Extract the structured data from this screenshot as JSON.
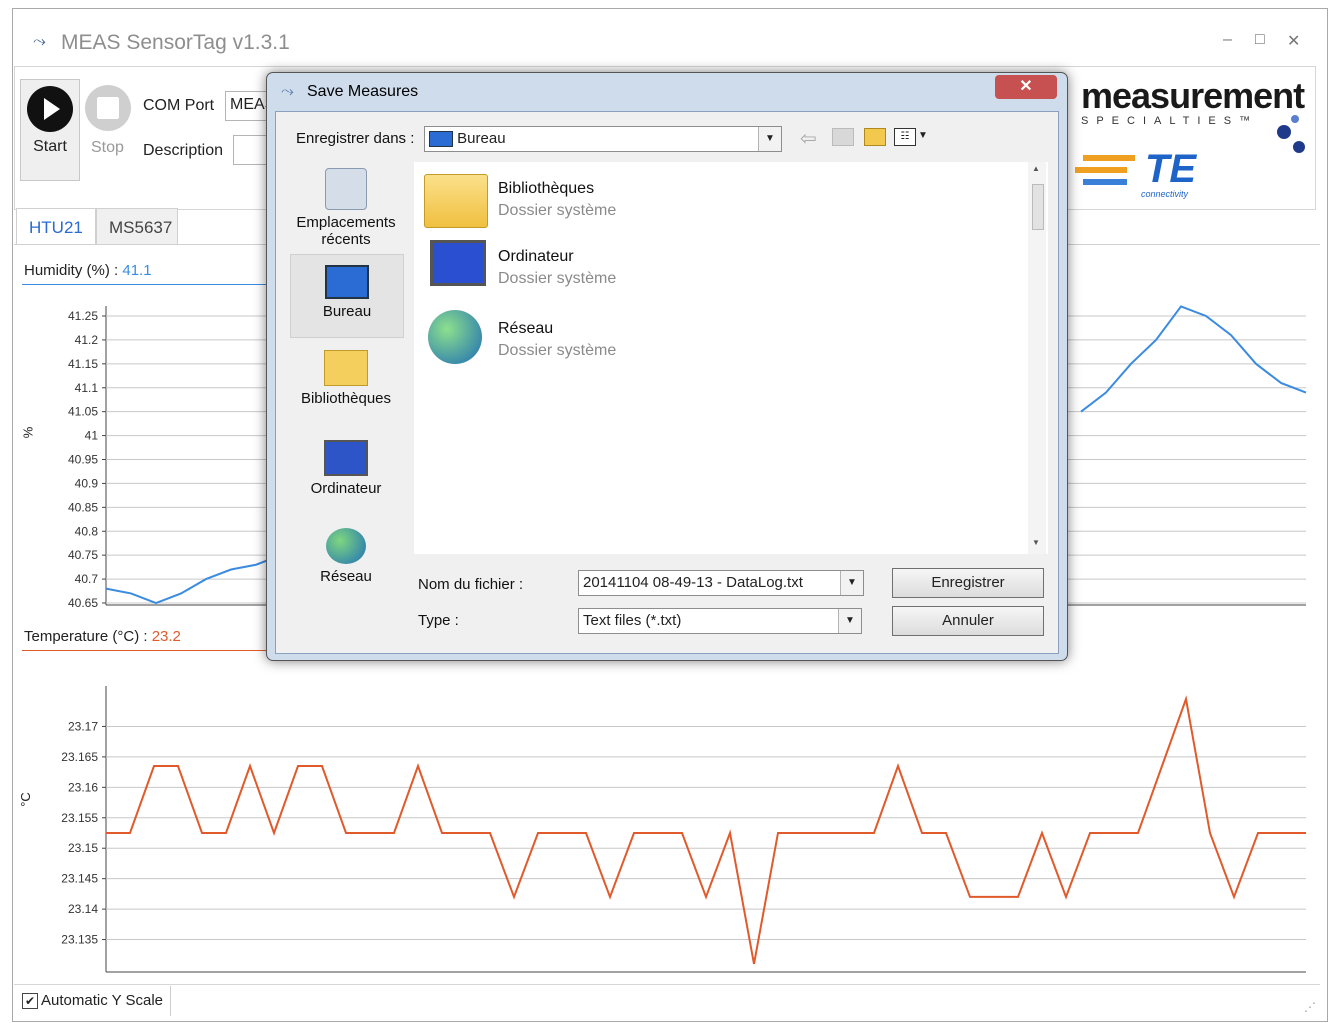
{
  "window": {
    "title": "MEAS SensorTag v1.3.1",
    "minimize": "–",
    "maximize": "□",
    "close": "✕"
  },
  "toolbar": {
    "start_label": "Start",
    "stop_label": "Stop",
    "com_port_label": "COM Port",
    "com_port_value": "MEAS",
    "description_label": "Description",
    "description_value": ""
  },
  "logo": {
    "brand": "measurement",
    "tagline": "SPECIALTIES™",
    "te": "TE",
    "te_sub": "connectivity"
  },
  "tabs": [
    {
      "label": "HTU21"
    },
    {
      "label": "MS5637"
    }
  ],
  "humidity": {
    "label": "Humidity (%) :",
    "value": "41.1",
    "unit": "%"
  },
  "temperature": {
    "label": "Temperature (°C) :",
    "value": "23.2",
    "unit": "°C"
  },
  "footer": {
    "auto_scale_label": "Automatic Y Scale",
    "auto_scale_checked": true
  },
  "dialog": {
    "title": "Save Measures",
    "close": "✕",
    "save_in_label": "Enregistrer dans :",
    "save_in_value": "Bureau",
    "nav_items": [
      {
        "label": "Emplacements récents",
        "icon": "recent-places-icon"
      },
      {
        "label": "Bureau",
        "icon": "desktop-icon"
      },
      {
        "label": "Bibliothèques",
        "icon": "libraries-icon"
      },
      {
        "label": "Ordinateur",
        "icon": "computer-icon"
      },
      {
        "label": "Réseau",
        "icon": "network-icon"
      }
    ],
    "files": [
      {
        "name": "Bibliothèques",
        "type": "Dossier système",
        "icon": "libraries-folder-icon"
      },
      {
        "name": "Ordinateur",
        "type": "Dossier système",
        "icon": "computer-icon"
      },
      {
        "name": "Réseau",
        "type": "Dossier système",
        "icon": "network-icon"
      }
    ],
    "filename_label": "Nom du fichier :",
    "filename_value": "20141104 08-49-13 - DataLog.txt",
    "type_label": "Type :",
    "type_value": "Text files (*.txt)",
    "save_button": "Enregistrer",
    "cancel_button": "Annuler"
  },
  "chart_data": [
    {
      "type": "line",
      "title": "Humidity (%) : 41.1",
      "ylabel": "%",
      "ylim": [
        40.65,
        41.25
      ],
      "yticks": [
        "41.25",
        "41.2",
        "41.15",
        "41.1",
        "41.05",
        "41",
        "40.95",
        "40.9",
        "40.85",
        "40.8",
        "40.75",
        "40.7",
        "40.65"
      ],
      "grid": true,
      "color": "#3b8be0",
      "visible_segments": [
        {
          "x": [
            0,
            1,
            2,
            3,
            4,
            5,
            6,
            7
          ],
          "y": [
            40.68,
            40.67,
            40.65,
            40.67,
            40.7,
            40.72,
            40.73,
            40.75
          ]
        },
        {
          "x": [
            39,
            40,
            41,
            42,
            43,
            44,
            45,
            46,
            47,
            48
          ],
          "y": [
            41.05,
            41.09,
            41.15,
            41.2,
            41.27,
            41.25,
            41.21,
            41.15,
            41.11,
            41.09
          ]
        }
      ],
      "x_count": 49
    },
    {
      "type": "line",
      "title": "Temperature (°C) : 23.2",
      "ylabel": "°C",
      "ylim": [
        23.13,
        23.175
      ],
      "yticks": [
        "23.17",
        "23.165",
        "23.16",
        "23.155",
        "23.15",
        "23.145",
        "23.14",
        "23.135"
      ],
      "grid": true,
      "color": "#e05a2b",
      "x": [
        0,
        1,
        2,
        3,
        4,
        5,
        6,
        7,
        8,
        9,
        10,
        11,
        12,
        13,
        14,
        15,
        16,
        17,
        18,
        19,
        20,
        21,
        22,
        23,
        24,
        25,
        26,
        27,
        28,
        29,
        30,
        31,
        32,
        33,
        34,
        35,
        36,
        37,
        38,
        39,
        40,
        41,
        42,
        43,
        44,
        45,
        46,
        47,
        48,
        49,
        50
      ],
      "y": [
        23.1525,
        23.1525,
        23.1635,
        23.1635,
        23.1525,
        23.1525,
        23.1635,
        23.1525,
        23.1635,
        23.1635,
        23.1525,
        23.1525,
        23.1525,
        23.1635,
        23.1525,
        23.1525,
        23.1525,
        23.142,
        23.1525,
        23.1525,
        23.1525,
        23.142,
        23.1525,
        23.1525,
        23.1525,
        23.142,
        23.1525,
        23.131,
        23.1525,
        23.1525,
        23.1525,
        23.1525,
        23.1525,
        23.1635,
        23.1525,
        23.1525,
        23.142,
        23.142,
        23.142,
        23.1525,
        23.142,
        23.1525,
        23.1525,
        23.1525,
        23.1635,
        23.1745,
        23.1525,
        23.142,
        23.1525,
        23.1525,
        23.1525
      ]
    }
  ]
}
